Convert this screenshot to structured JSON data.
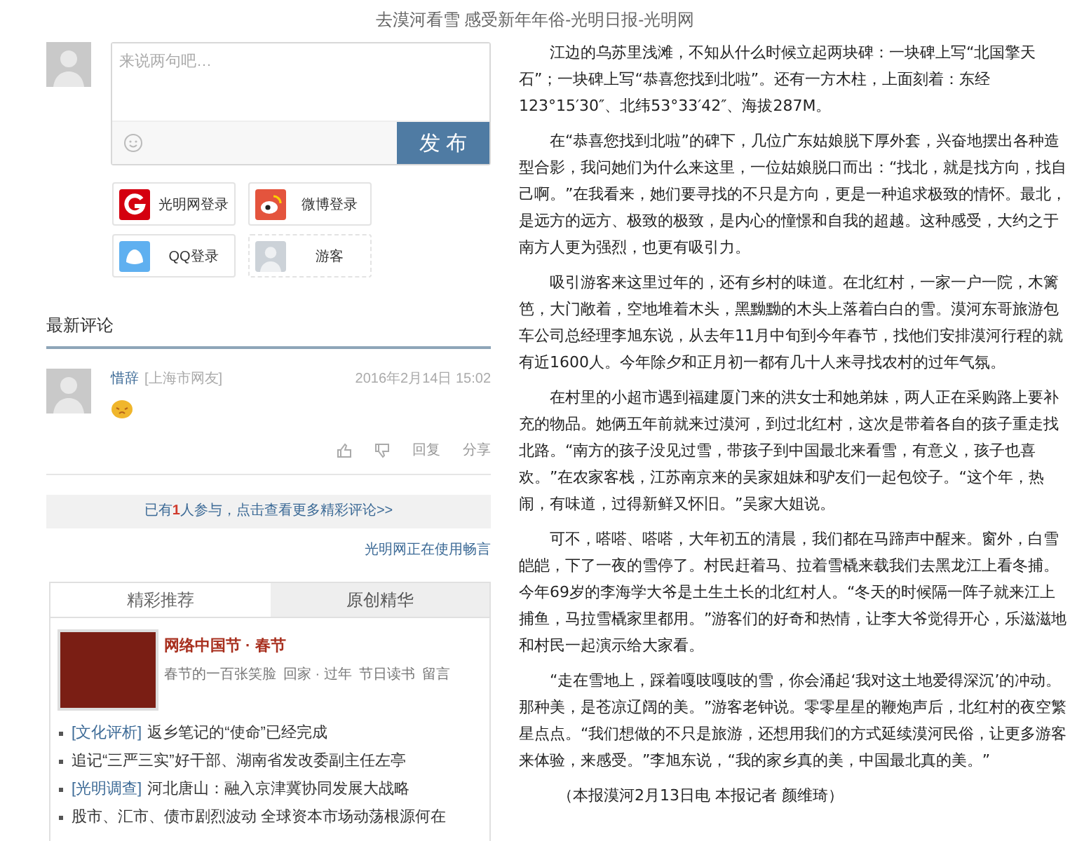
{
  "page_title": "去漠河看雪 感受新年年俗-光明日报-光明网",
  "comment_box": {
    "placeholder": "来说两句吧…",
    "submit": "发 布"
  },
  "login_buttons": [
    {
      "kind": "guangming",
      "label": "光明网登录"
    },
    {
      "kind": "weibo",
      "label": "微博登录"
    },
    {
      "kind": "qq",
      "label": "QQ登录"
    },
    {
      "kind": "guest",
      "label": "游客"
    }
  ],
  "latest_comments": {
    "title": "最新评论",
    "comments": [
      {
        "user": "惜辞",
        "location": "[上海市网友]",
        "time": "2016年2月14日 15:02",
        "actions": [
          "回复",
          "分享"
        ]
      }
    ]
  },
  "more_comments": "已有**1**人参与，点击查看更多精彩评论>>",
  "powered_by": "光明网正在使用畅言",
  "recommend": {
    "tabs": [
      {
        "label": "精彩推荐",
        "selected": true
      },
      {
        "label": "原创精华",
        "selected": false
      }
    ],
    "feature": {
      "title": "网络中国节 · 春节",
      "links": [
        "春节的一百张笑脸",
        "回家 · 过年",
        "节日读书",
        "留言"
      ]
    },
    "items": [
      {
        "tag": "[文化评析]",
        "text": "返乡笔记的“使命”已经完成"
      },
      {
        "text": "追记“三严三实”好干部、湖南省发改委副主任左亭"
      },
      {
        "tag": "[光明调查]",
        "text": "河北唐山：融入京津冀协同发展大战略"
      },
      {
        "text": "股市、汇市、债市剧烈波动 全球资本市场动荡根源何在"
      }
    ]
  },
  "article": {
    "paragraphs": [
      "江边的乌苏里浅滩，不知从什么时候立起两块碑：一块碑上写“北国擎天石”；一块碑上写“恭喜您找到北啦”。还有一方木柱，上面刻着：东经123°15′30″、北纬53°33′42″、海拔287M。",
      "在“恭喜您找到北啦”的碑下，几位广东姑娘脱下厚外套，兴奋地摆出各种造型合影，我问她们为什么来这里，一位姑娘脱口而出：“找北，就是找方向，找自己啊。”在我看来，她们要寻找的不只是方向，更是一种追求极致的情怀。最北，是远方的远方、极致的极致，是内心的憧憬和自我的超越。这种感受，大约之于南方人更为强烈，也更有吸引力。",
      "吸引游客来这里过年的，还有乡村的味道。在北红村，一家一户一院，木篱笆，大门敞着，空地堆着木头，黑黝黝的木头上落着白白的雪。漠河东哥旅游包车公司总经理李旭东说，从去年11月中旬到今年春节，找他们安排漠河行程的就有近1600人。今年除夕和正月初一都有几十人来寻找农村的过年气氛。",
      "在村里的小超市遇到福建厦门来的洪女士和她弟妹，两人正在采购路上要补充的物品。她俩五年前就来过漠河，到过北红村，这次是带着各自的孩子重走找北路。“南方的孩子没见过雪，带孩子到中国最北来看雪，有意义，孩子也喜欢。”在农家客栈，江苏南京来的吴家姐妹和驴友们一起包饺子。“这个年，热闹，有味道，过得新鲜又怀旧。”吴家大姐说。",
      "可不，嗒嗒、嗒嗒，大年初五的清晨，我们都在马蹄声中醒来。窗外，白雪皑皑，下了一夜的雪停了。村民赶着马、拉着雪橇来载我们去黑龙江上看冬捕。今年69岁的李海学大爷是土生土长的北红村人。“冬天的时候隔一阵子就来江上捕鱼，马拉雪橇家里都用。”游客们的好奇和热情，让李大爷觉得开心，乐滋滋地和村民一起演示给大家看。",
      "“走在雪地上，踩着嘎吱嘎吱的雪，你会涌起‘我对这土地爱得深沉’的冲动。那种美，是苍凉辽阔的美。”游客老钟说。零零星星的鞭炮声后，北红村的夜空繁星点点。“我们想做的不只是旅游，还想用我们的方式延续漠河民俗，让更多游客来体验，来感受。”李旭东说，“我的家乡真的美，中国最北真的美。”",
      "（本报漠河2月13日电 本报记者 颜维琦）"
    ]
  }
}
